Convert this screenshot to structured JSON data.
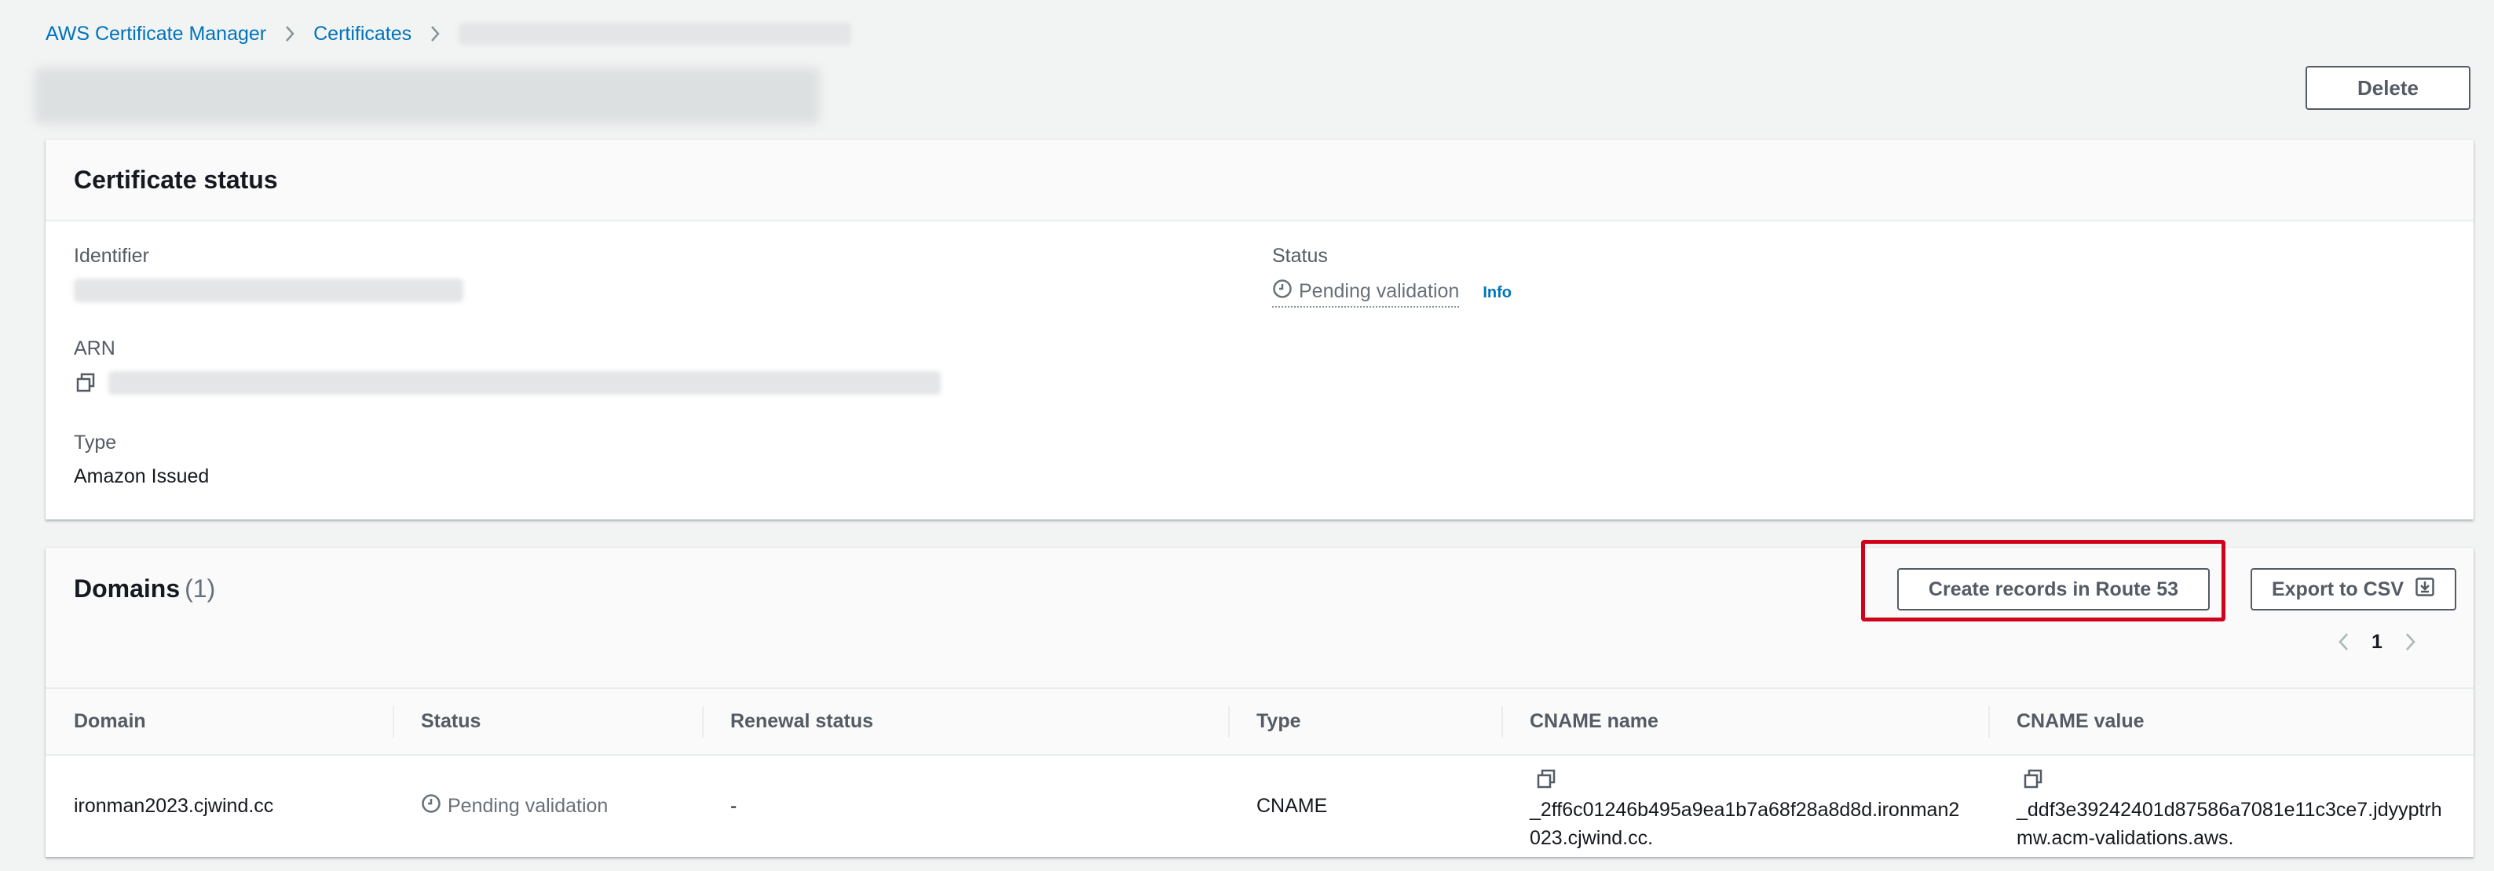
{
  "breadcrumb": {
    "items": [
      "AWS Certificate Manager",
      "Certificates"
    ]
  },
  "header": {
    "delete_label": "Delete"
  },
  "certificate_status": {
    "title": "Certificate status",
    "identifier_label": "Identifier",
    "arn_label": "ARN",
    "type_label": "Type",
    "type_value": "Amazon Issued",
    "status_label": "Status",
    "status_value": "Pending validation",
    "info_label": "Info"
  },
  "domains": {
    "title": "Domains",
    "count": "(1)",
    "create_records_label": "Create records in Route 53",
    "export_label": "Export to CSV",
    "page": "1",
    "columns": [
      "Domain",
      "Status",
      "Renewal status",
      "Type",
      "CNAME name",
      "CNAME value"
    ],
    "rows": [
      {
        "domain": "ironman2023.cjwind.cc",
        "status": "Pending validation",
        "renewal_status": "-",
        "type": "CNAME",
        "cname_name": "_2ff6c01246b495a9ea1b7a68f28a8d8d.ironman2023.cjwind.cc.",
        "cname_value": "_ddf3e39242401d87586a7081e11c3ce7.jdyyptrhmw.acm-validations.aws."
      }
    ]
  },
  "colors": {
    "link": "#0073bb",
    "highlight": "#d0021b",
    "background": "#f2f3f3"
  },
  "icons": {
    "chevron": "chevron-right-icon",
    "clock": "clock-icon",
    "copy": "copy-icon",
    "download": "download-icon"
  }
}
